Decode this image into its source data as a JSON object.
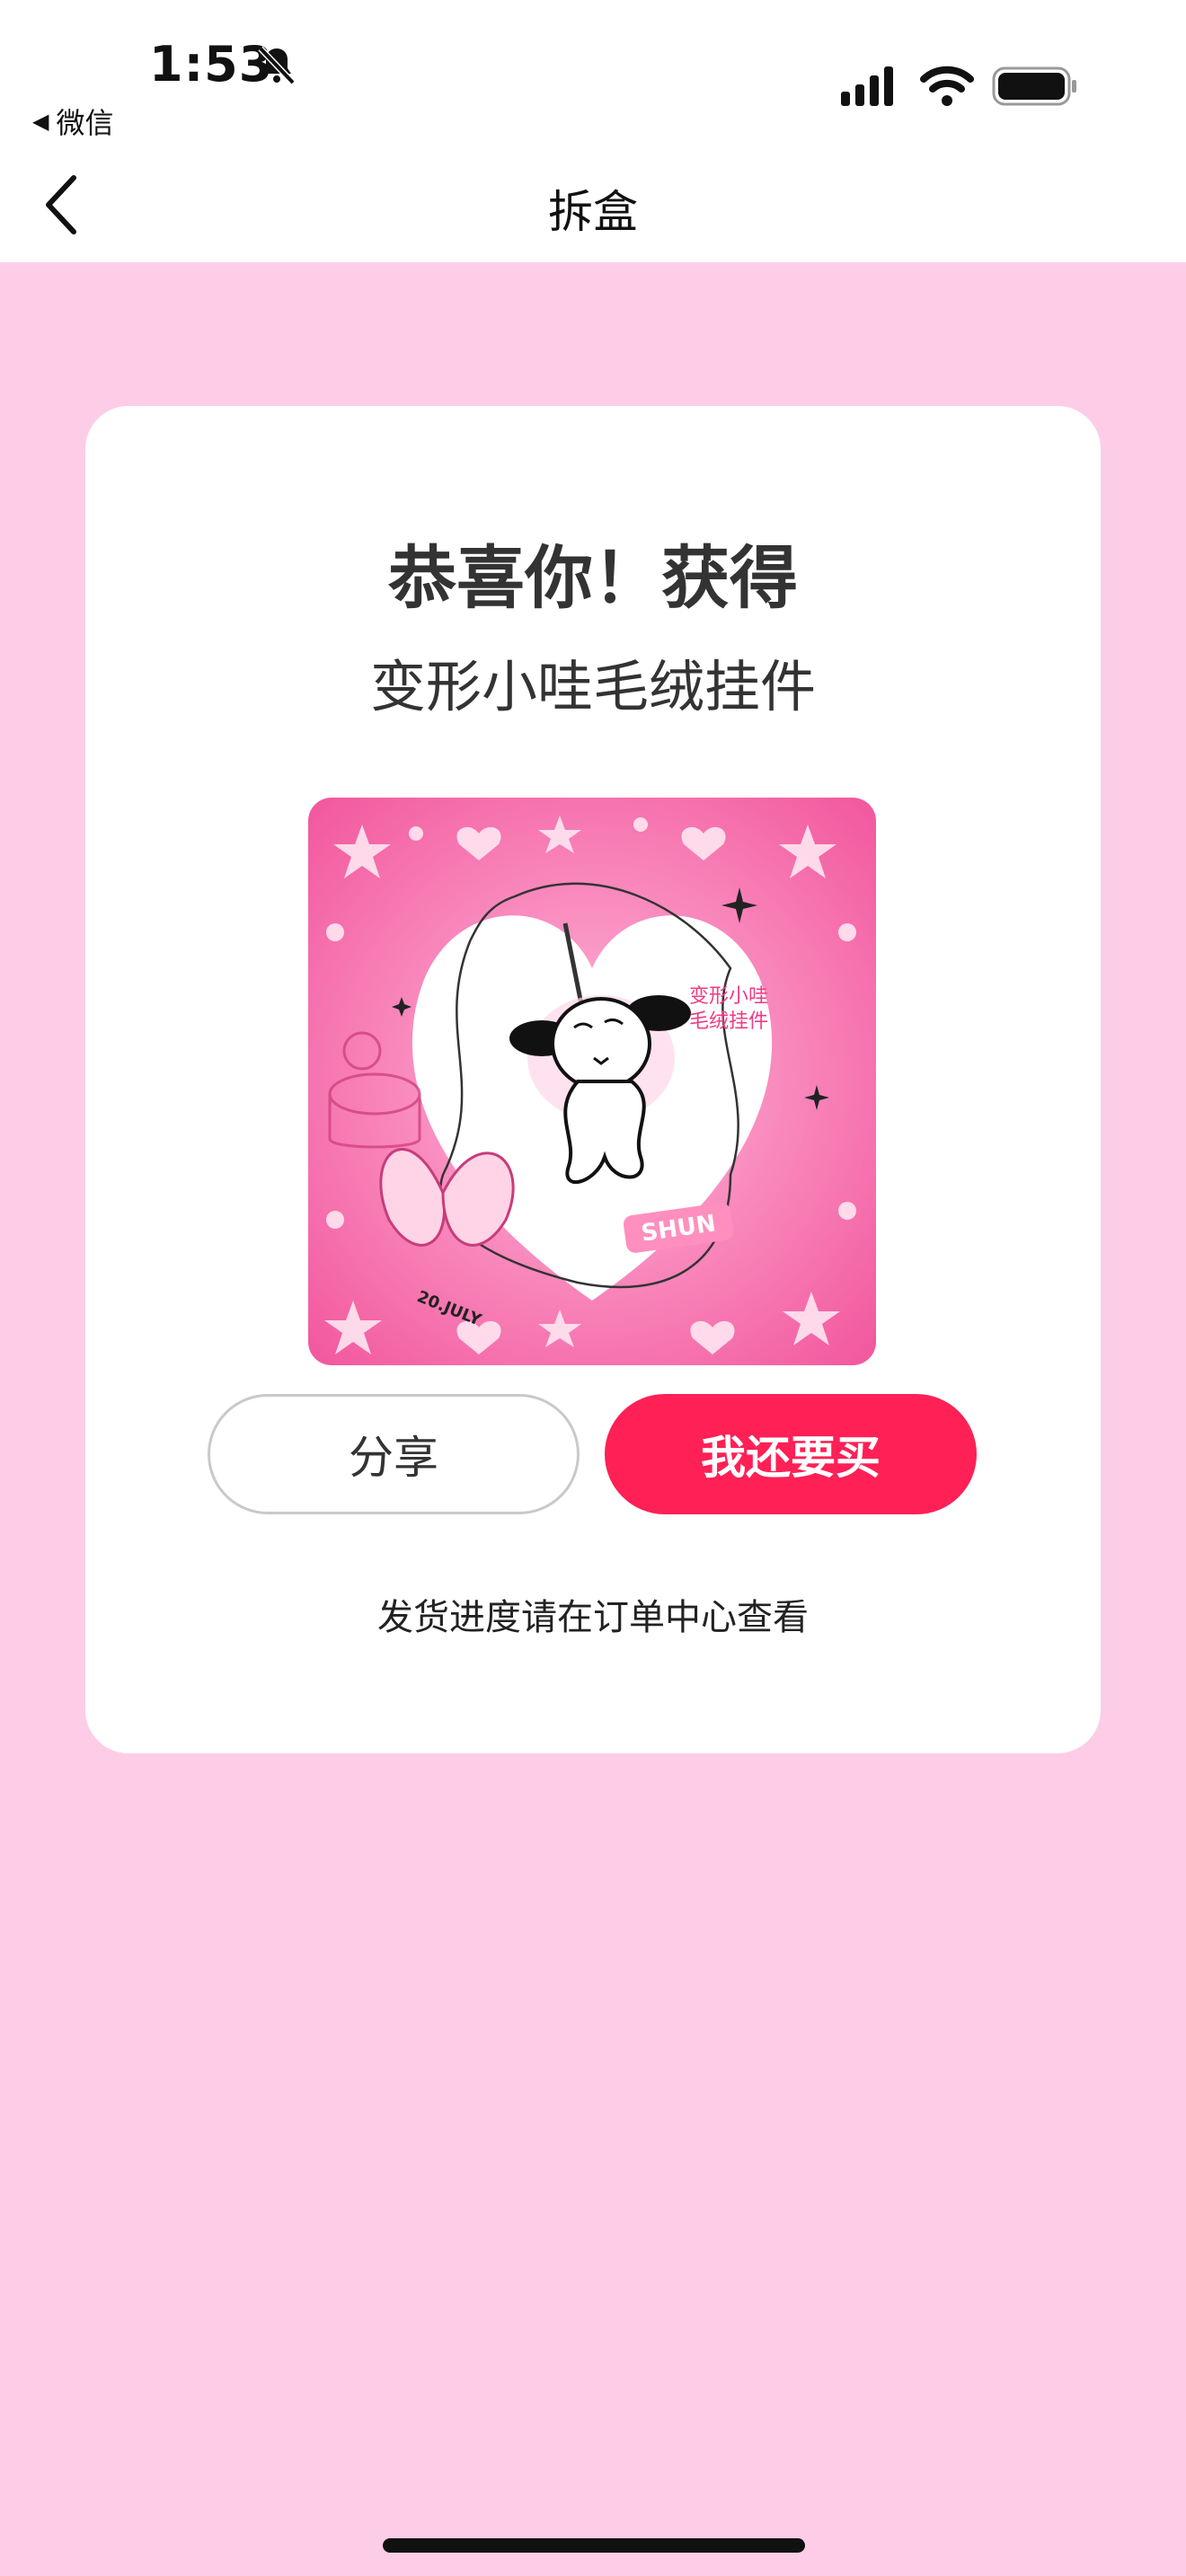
{
  "status_bar": {
    "time": "1:53",
    "back_app_label": "微信",
    "icons": [
      "bell-slash-icon",
      "signal-icon",
      "wifi-icon",
      "battery-icon"
    ]
  },
  "nav": {
    "title": "拆盒",
    "back_icon": "chevron-left-icon"
  },
  "card": {
    "congrats": "恭喜你！获得",
    "prize_name": "变形小哇毛绒挂件",
    "image": {
      "label_text_line1": "变形小哇",
      "label_text_line2": "毛绒挂件",
      "badge_text": "SHUN",
      "date_text": "20.JULY"
    },
    "share_button": "分享",
    "buy_button": "我还要买",
    "hint": "发货进度请在订单中心查看"
  },
  "colors": {
    "page_background": "#fdcde8",
    "accent": "#ff2055",
    "card": "#ffffff"
  }
}
